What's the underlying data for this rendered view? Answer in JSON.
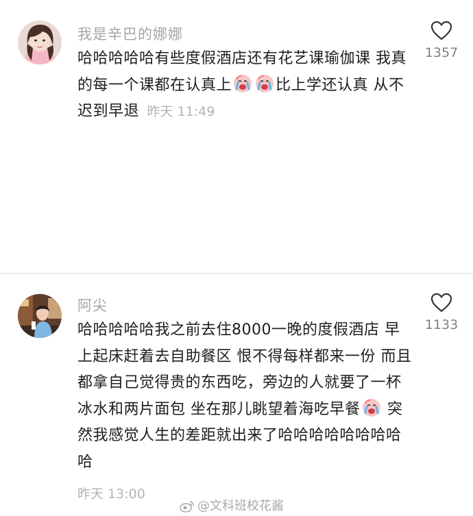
{
  "comments": [
    {
      "username": "我是辛巴的娜娜",
      "text_parts": [
        "哈哈哈哈哈有些度假酒店还有花艺课瑜伽课 我真的每一个课都在认真上",
        "比上学还认真 从不迟到早退"
      ],
      "emoji": "crying-face-emoji",
      "time": "昨天 11:49",
      "likes": "1357",
      "avatar_color": "#e7c9c4"
    },
    {
      "username": "阿尖",
      "text_parts": [
        "哈哈哈哈哈我之前去住8000一晚的度假酒店 早上起床赶着去自助餐区 恨不得每样都来一份 而且都拿自己觉得贵的东西吃，旁边的人就要了一杯冰水和两片面包 坐在那儿眺望着海吃早餐",
        " 突然我感觉人生的差距就出来了哈哈哈哈哈哈哈哈哈"
      ],
      "emoji": "crying-face-emoji",
      "time": "昨天 13:00",
      "likes": "1133",
      "avatar_color": "#6b4a33"
    }
  ],
  "watermark": "@文科班校花酱",
  "colors": {
    "username": "#a6a6a6",
    "text": "#1e1e1e",
    "time": "#b4b4b4",
    "like_count": "#808080",
    "divider": "#f0f0f0"
  }
}
